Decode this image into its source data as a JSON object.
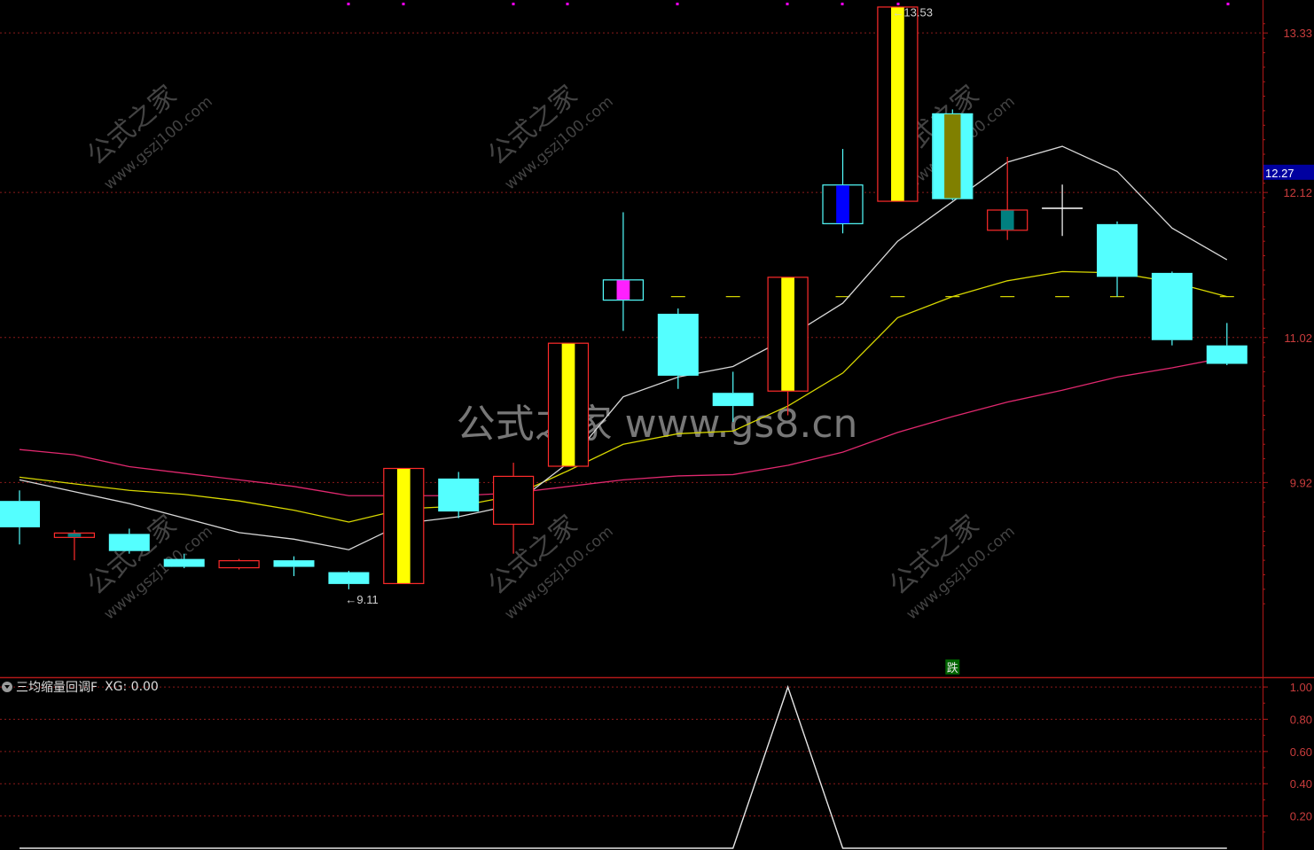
{
  "indicator": {
    "name": "三均缩量回调F",
    "xg_label": "XG: 0.00"
  },
  "watermarks": {
    "center": "公式之家 www.gs8.cn",
    "tile_cn": "公式之家",
    "tile_url": "www.gszj100.com"
  },
  "annotations": {
    "high_label": "←13.53",
    "low_label": "←9.11",
    "signal_label": "跌",
    "price_tag": "12.27"
  },
  "colors": {
    "grid": "#8b1a1a",
    "axis": "#b01818",
    "axis_text": "#c83c3c",
    "up": "#ff2b2b",
    "down": "#54ffff",
    "yellow_fill": "#ffff00",
    "magenta_fill": "#ff20ff",
    "blue_fill": "#0000ff",
    "teal_fill": "#008080",
    "olive_fill": "#808000",
    "ma_white": "#d8d8d8",
    "ma_yellow": "#d8d800",
    "ma_pink": "#e0286e",
    "price_tag_bg": "#0000a0"
  },
  "chart_data": [
    {
      "type": "candlestick",
      "ylim": [
        8.45,
        13.58
      ],
      "yticks": [
        9.92,
        11.02,
        12.12,
        13.33
      ],
      "tick_labels": [
        "9.92",
        "11.02",
        "12.12",
        "13.33"
      ],
      "reference_line": 11.33,
      "candles": [
        {
          "o": 9.78,
          "c": 9.58,
          "h": 9.86,
          "l": 9.45,
          "fill": "down"
        },
        {
          "o": 9.5,
          "c": 9.54,
          "h": 9.56,
          "l": 9.33,
          "fill": "teal"
        },
        {
          "o": 9.53,
          "c": 9.4,
          "h": 9.57,
          "l": 9.38,
          "fill": "down"
        },
        {
          "o": 9.34,
          "c": 9.28,
          "h": 9.38,
          "l": 9.27,
          "fill": "down"
        },
        {
          "o": 9.27,
          "c": 9.33,
          "h": 9.34,
          "l": 9.26,
          "fill": "hollow"
        },
        {
          "o": 9.33,
          "c": 9.28,
          "h": 9.36,
          "l": 9.21,
          "fill": "down"
        },
        {
          "o": 9.24,
          "c": 9.15,
          "h": 9.25,
          "l": 9.11,
          "fill": "down"
        },
        {
          "o": 9.15,
          "c": 10.03,
          "h": 10.03,
          "l": 9.15,
          "fill": "yellow"
        },
        {
          "o": 9.95,
          "c": 9.7,
          "h": 10.0,
          "l": 9.65,
          "fill": "down"
        },
        {
          "o": 9.6,
          "c": 9.97,
          "h": 10.07,
          "l": 9.38,
          "fill": "hollow"
        },
        {
          "o": 10.04,
          "c": 10.98,
          "h": 10.98,
          "l": 10.04,
          "fill": "yellow"
        },
        {
          "o": 11.46,
          "c": 11.3,
          "h": 11.97,
          "l": 11.07,
          "fill": "magenta"
        },
        {
          "o": 11.2,
          "c": 10.73,
          "h": 11.24,
          "l": 10.63,
          "fill": "down"
        },
        {
          "o": 10.6,
          "c": 10.5,
          "h": 10.76,
          "l": 10.38,
          "fill": "down"
        },
        {
          "o": 10.61,
          "c": 11.48,
          "h": 11.48,
          "l": 10.43,
          "fill": "yellow"
        },
        {
          "o": 12.18,
          "c": 11.88,
          "h": 12.45,
          "l": 11.81,
          "fill": "blue"
        },
        {
          "o": 12.05,
          "c": 13.53,
          "h": 13.53,
          "l": 12.05,
          "fill": "yellow"
        },
        {
          "o": 12.72,
          "c": 12.07,
          "h": 12.75,
          "l": 12.06,
          "fill": "olive"
        },
        {
          "o": 11.83,
          "c": 11.99,
          "h": 12.39,
          "l": 11.76,
          "fill": "teal"
        },
        {
          "o": 12.0,
          "c": 12.0,
          "h": 12.18,
          "l": 11.79,
          "fill": "cross"
        },
        {
          "o": 11.88,
          "c": 11.48,
          "h": 11.9,
          "l": 11.33,
          "fill": "down"
        },
        {
          "o": 11.51,
          "c": 11.0,
          "h": 11.52,
          "l": 10.96,
          "fill": "down"
        },
        {
          "o": 10.96,
          "c": 10.82,
          "h": 11.13,
          "l": 10.81,
          "fill": "down"
        }
      ],
      "ma_white": [
        9.94,
        9.85,
        9.76,
        9.65,
        9.54,
        9.49,
        9.41,
        9.61,
        9.66,
        9.75,
        10.07,
        10.57,
        10.72,
        10.8,
        11.02,
        11.28,
        11.75,
        12.05,
        12.35,
        12.47,
        12.28,
        11.85,
        11.61
      ],
      "ma_yellow": [
        9.96,
        9.91,
        9.86,
        9.83,
        9.78,
        9.71,
        9.62,
        9.72,
        9.74,
        9.82,
        10.01,
        10.21,
        10.29,
        10.31,
        10.5,
        10.75,
        11.17,
        11.33,
        11.45,
        11.52,
        11.51,
        11.44,
        11.33
      ],
      "ma_pink": [
        10.17,
        10.13,
        10.04,
        9.99,
        9.94,
        9.89,
        9.82,
        9.82,
        9.82,
        9.84,
        9.89,
        9.94,
        9.97,
        9.98,
        10.05,
        10.15,
        10.3,
        10.42,
        10.53,
        10.62,
        10.72,
        10.79,
        10.87
      ]
    },
    {
      "type": "line",
      "name": "XG",
      "ylim": [
        0,
        1.05
      ],
      "yticks": [
        0.2,
        0.4,
        0.6,
        0.8,
        1.0
      ],
      "tick_labels": [
        "0.20",
        "0.40",
        "0.60",
        "0.80",
        "1.00"
      ],
      "values": [
        0,
        0,
        0,
        0,
        0,
        0,
        0,
        0,
        0,
        0,
        0,
        0,
        0,
        0,
        1,
        0,
        0,
        0,
        0,
        0,
        0,
        0,
        0
      ]
    }
  ]
}
